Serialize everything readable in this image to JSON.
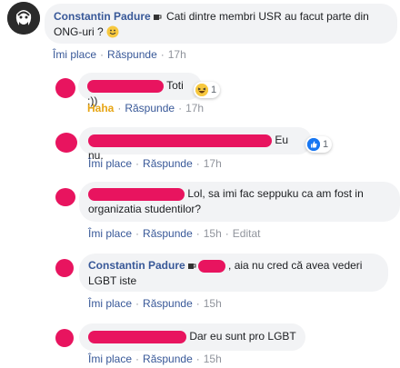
{
  "comments": [
    {
      "author": "Constantin Padure",
      "text": "Cati dintre membri USR au facut parte din ONG-uri ?",
      "like": "Îmi place",
      "reply": "Răspunde",
      "time": "17h"
    },
    {
      "text": "Toti :))",
      "reaction_label": "Haha",
      "reply": "Răspunde",
      "time": "17h",
      "reaction_count": "1"
    },
    {
      "text": "Eu nu.",
      "like": "Îmi place",
      "reply": "Răspunde",
      "time": "17h",
      "reaction_count": "1"
    },
    {
      "text_line1": "Lol, sa imi fac seppuku ca am fost in",
      "text_line2": "organizatia studentilor?",
      "like": "Îmi place",
      "reply": "Răspunde",
      "time": "15h",
      "edited": "Editat"
    },
    {
      "author": "Constantin Padure",
      "text_line1": ", aia nu cred că avea vederi",
      "text_line2": "LGBT iste",
      "like": "Îmi place",
      "reply": "Răspunde",
      "time": "15h"
    },
    {
      "text": "Dar eu sunt pro LGBT",
      "like": "Îmi place",
      "reply": "Răspunde",
      "time": "15h"
    }
  ],
  "colors": {
    "link": "#385898",
    "redaction": "#e8145f",
    "bubble": "#f2f3f5",
    "haha": "#e7a514",
    "like_blue": "#1877f2"
  }
}
